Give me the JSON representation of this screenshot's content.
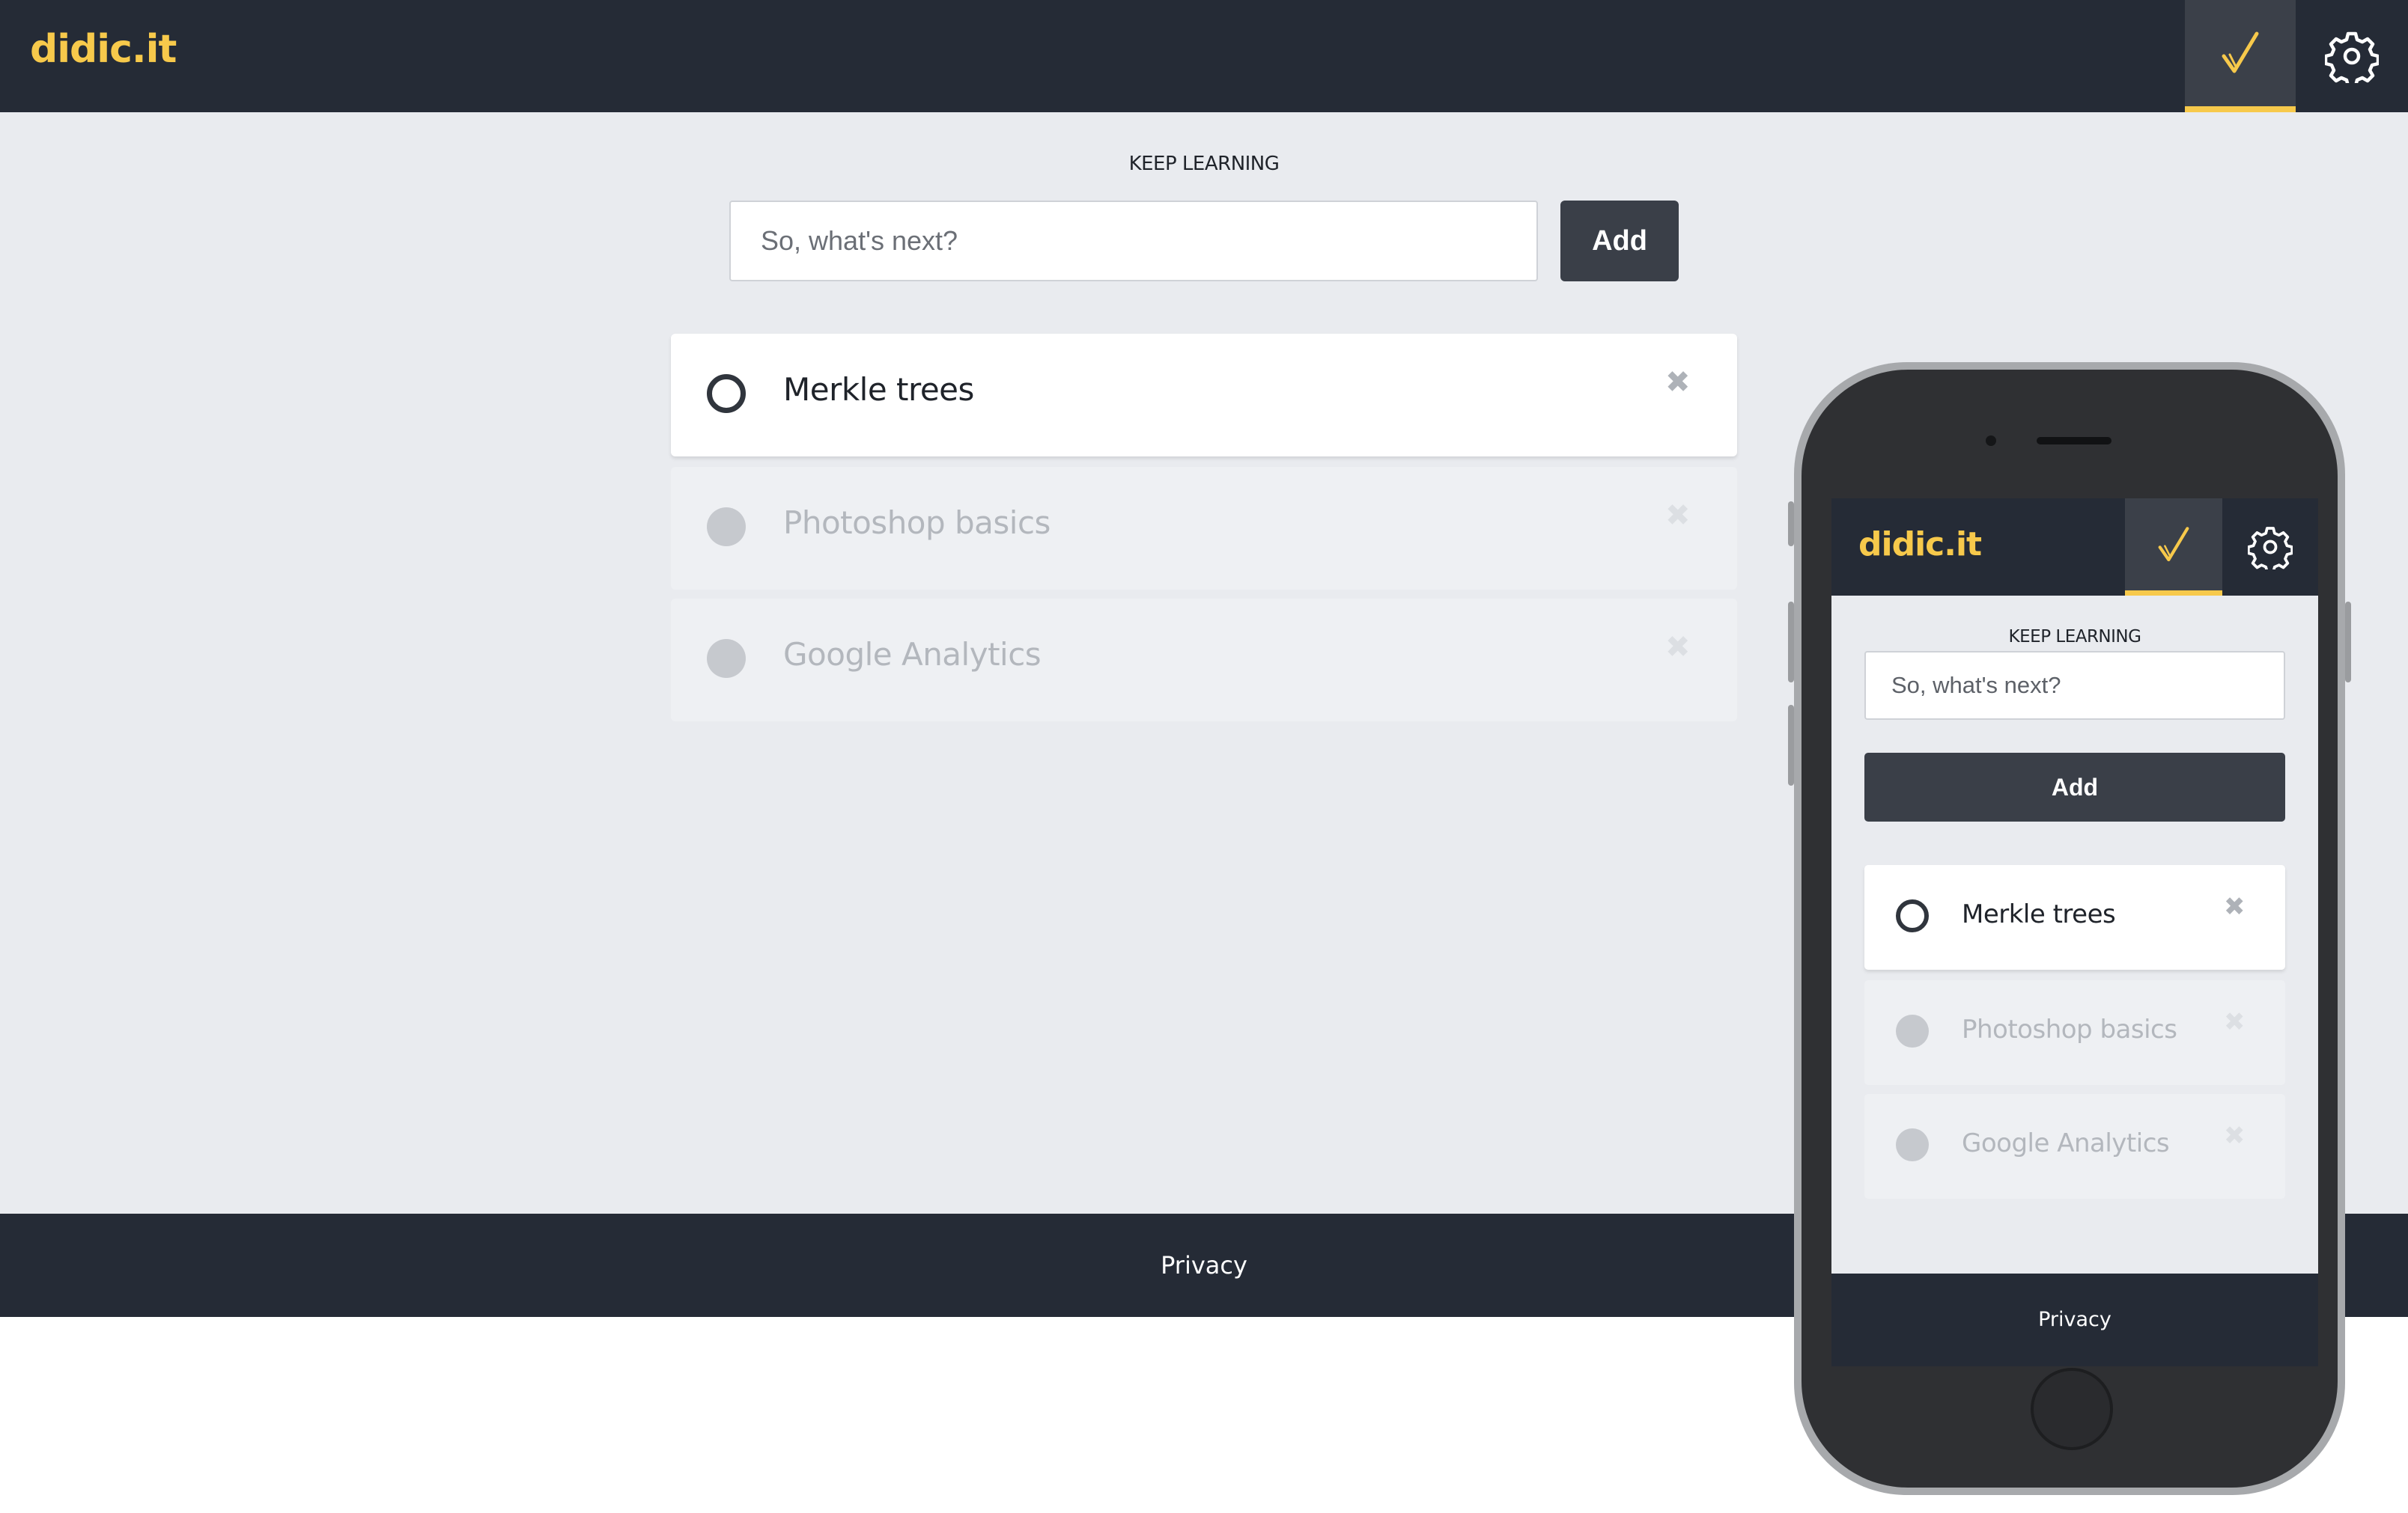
{
  "brand": {
    "logo": "didic.it",
    "accent": "#f7c94b"
  },
  "desktop": {
    "nav": {
      "check_icon": "checkmark-icon",
      "settings_icon": "gear-icon"
    },
    "section_title": "KEEP LEARNING",
    "input": {
      "placeholder": "So, what's next?",
      "value": ""
    },
    "add_label": "Add",
    "items": [
      {
        "label": "Merkle trees",
        "done": false
      },
      {
        "label": "Photoshop basics",
        "done": true
      },
      {
        "label": "Google Analytics",
        "done": true
      }
    ],
    "footer": {
      "privacy": "Privacy"
    }
  },
  "mobile": {
    "logo": "didic.it",
    "section_title": "KEEP LEARNING",
    "input": {
      "placeholder": "So, what's next?",
      "value": ""
    },
    "add_label": "Add",
    "items": [
      {
        "label": "Merkle trees",
        "done": false
      },
      {
        "label": "Photoshop basics",
        "done": true
      },
      {
        "label": "Google Analytics",
        "done": true
      }
    ],
    "footer": {
      "privacy": "Privacy"
    }
  },
  "colors": {
    "header_bg": "#252b36",
    "page_bg": "#e9ebef",
    "button_bg": "#3a3f48"
  }
}
